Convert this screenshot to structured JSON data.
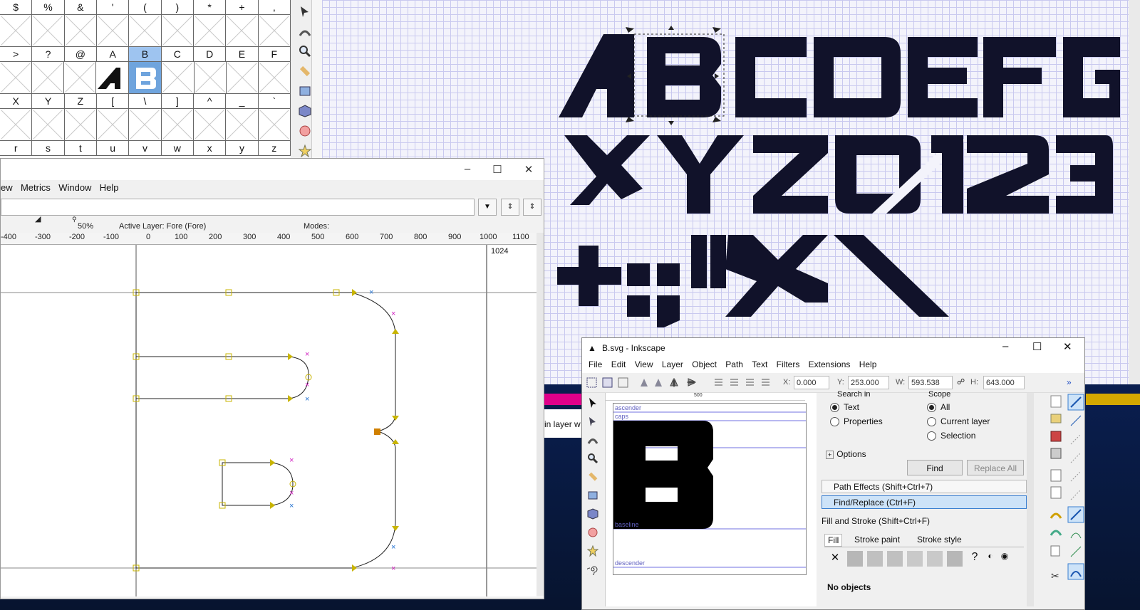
{
  "glyph_table": {
    "rows": [
      {
        "labels": [
          "$",
          "%",
          "&",
          "'",
          "(",
          ")",
          "*",
          "+",
          ","
        ],
        "selected": []
      },
      {
        "labels": [
          ">",
          "?",
          "@",
          "A",
          "B",
          "C",
          "D",
          "E",
          "F"
        ],
        "selected": [
          4
        ]
      },
      {
        "labels": [
          "X",
          "Y",
          "Z",
          "[",
          "\\",
          "]",
          "^",
          "_",
          "`"
        ],
        "selected": []
      },
      {
        "labels": [
          "r",
          "s",
          "t",
          "u",
          "v",
          "w",
          "x",
          "y",
          "z"
        ],
        "selected": []
      }
    ]
  },
  "ink_main": {
    "preview_rows": [
      "ABCDEFG",
      "XYZØ12",
      "+:;\"*\\"
    ]
  },
  "fontforge": {
    "menu": [
      "ew",
      "Metrics",
      "Window",
      "Help"
    ],
    "info": {
      "zoom": "50%",
      "active_layer": "Active Layer: Fore (Fore)",
      "modes": "Modes:"
    },
    "ruler_ticks": [
      "-400",
      "-300",
      "-200",
      "-100",
      "0",
      "100",
      "200",
      "300",
      "400",
      "500",
      "600",
      "700",
      "800",
      "900",
      "1000",
      "1100"
    ],
    "em_label": "1024"
  },
  "inkscape_b": {
    "title": "B.svg - Inkscape",
    "menu": [
      "File",
      "Edit",
      "View",
      "Layer",
      "Object",
      "Path",
      "Text",
      "Filters",
      "Extensions",
      "Help"
    ],
    "toolbar": {
      "x_label": "X:",
      "x": "0.000",
      "y_label": "Y:",
      "y": "253.000",
      "w_label": "W:",
      "w": "593.538",
      "h_label": "H:",
      "h": "643.000"
    },
    "canvas": {
      "ruler_mid": "500",
      "guides": [
        "ascender",
        "caps",
        "baseline",
        "descender"
      ],
      "glyph": "B"
    },
    "find": {
      "search_in": "Search in",
      "scope": "Scope",
      "text": "Text",
      "properties": "Properties",
      "all": "All",
      "current_layer": "Current layer",
      "selection": "Selection",
      "options": "Options",
      "find_btn": "Find",
      "replace_btn": "Replace All"
    },
    "docks": [
      "Path Effects  (Shift+Ctrl+7)",
      "Find/Replace (Ctrl+F)",
      "Fill and Stroke (Shift+Ctrl+F)"
    ],
    "fill_tabs": [
      "Fill",
      "Stroke paint",
      "Stroke style"
    ],
    "no_objects": "No objects"
  },
  "background_text": "in layer w",
  "colors": {
    "selection_blue": "#6fa4dd",
    "glyph_fill": "#11122a",
    "accent": "#3a7fd0"
  }
}
